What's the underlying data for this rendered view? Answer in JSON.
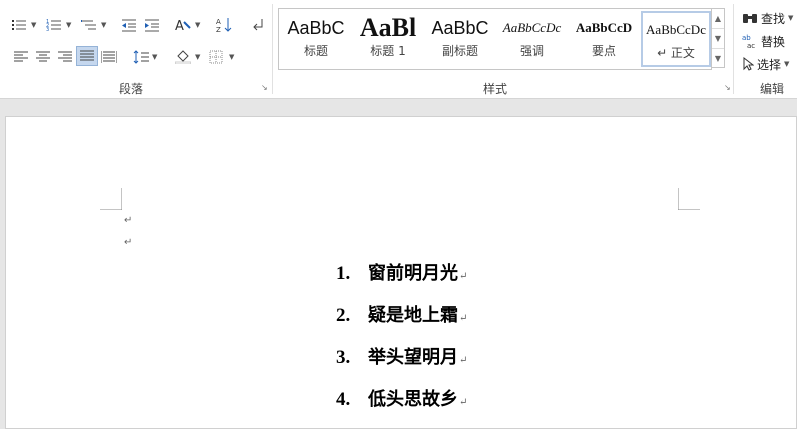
{
  "ribbon": {
    "paragraph_group_label": "段落",
    "styles_group_label": "样式",
    "editing_group_label": "编辑",
    "styles": [
      {
        "sample": "AaBbC",
        "name": "标题"
      },
      {
        "sample": "AaBl",
        "name": "标题 1"
      },
      {
        "sample": "AaBbC",
        "name": "副标题"
      },
      {
        "sample": "AaBbCcDc",
        "name": "强调"
      },
      {
        "sample": "AaBbCcD",
        "name": "要点"
      },
      {
        "sample": "AaBbCcDc",
        "name": "↵ 正文"
      }
    ],
    "editing": {
      "find_label": "查找",
      "replace_label": "替换",
      "select_label": "选择"
    }
  },
  "document": {
    "list_items": [
      {
        "number": "1.",
        "text": "窗前明月光"
      },
      {
        "number": "2.",
        "text": "疑是地上霜"
      },
      {
        "number": "3.",
        "text": "举头望明月"
      },
      {
        "number": "4.",
        "text": "低头思故乡"
      }
    ],
    "return_mark": "↵"
  },
  "colors": {
    "active_button": "#c5d7ee",
    "selected_style_border": "#b6cbe6",
    "page": "#ffffff",
    "background": "#e6e6e6"
  }
}
